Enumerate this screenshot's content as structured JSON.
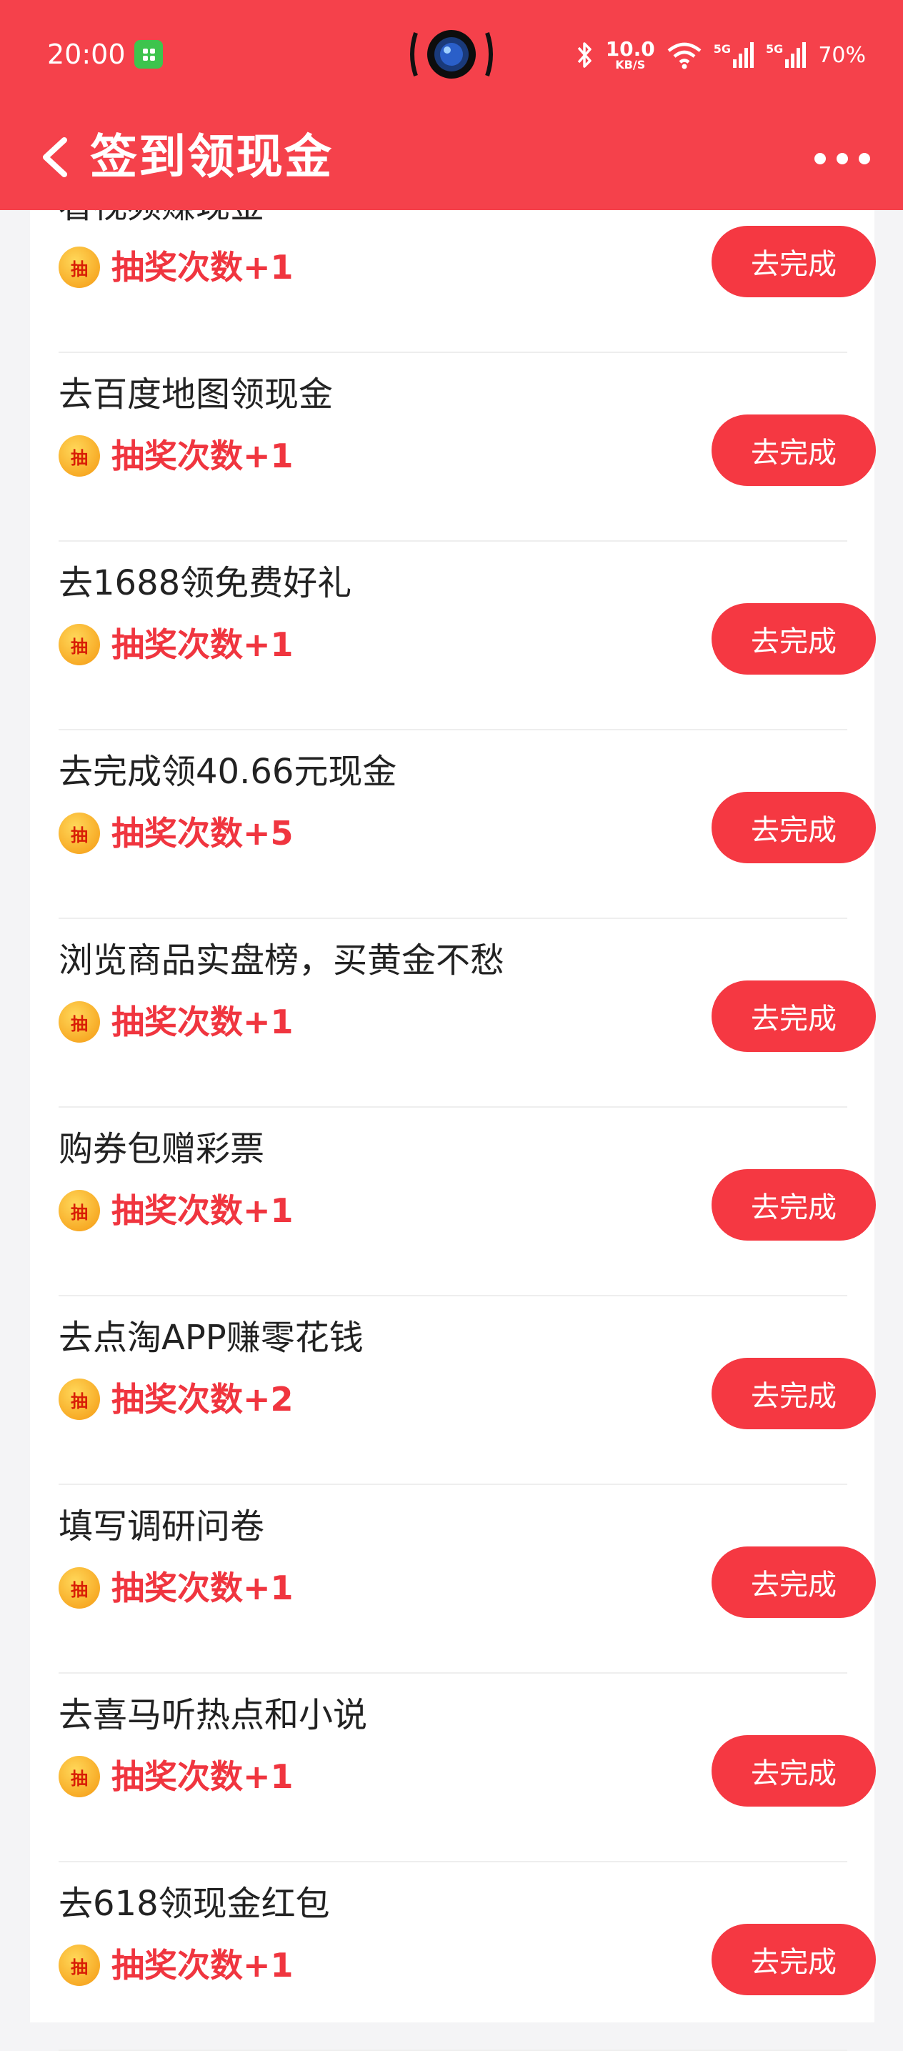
{
  "status_bar": {
    "time": "20:00",
    "network_speed_value": "10.0",
    "network_speed_unit": "KB/S",
    "signal_1_label": "5G",
    "signal_2_label": "5G",
    "battery": "70%"
  },
  "header": {
    "title": "签到领现金"
  },
  "colors": {
    "header_bg": "#f5414b",
    "accent_red": "#f0353f",
    "button_bg": "#f53842",
    "page_bg": "#f4f4f6"
  },
  "tasks": [
    {
      "title": "看视频赚现金",
      "reward": "抽奖次数+1",
      "button": "去完成",
      "reward_icon": "抽"
    },
    {
      "title": "去百度地图领现金",
      "reward": "抽奖次数+1",
      "button": "去完成",
      "reward_icon": "抽"
    },
    {
      "title": "去1688领免费好礼",
      "reward": "抽奖次数+1",
      "button": "去完成",
      "reward_icon": "抽"
    },
    {
      "title": "去完成领40.66元现金",
      "reward": "抽奖次数+5",
      "button": "去完成",
      "reward_icon": "抽"
    },
    {
      "title": "浏览商品实盘榜，买黄金不愁",
      "reward": "抽奖次数+1",
      "button": "去完成",
      "reward_icon": "抽"
    },
    {
      "title": "购券包赠彩票",
      "reward": "抽奖次数+1",
      "button": "去完成",
      "reward_icon": "抽"
    },
    {
      "title": "去点淘APP赚零花钱",
      "reward": "抽奖次数+2",
      "button": "去完成",
      "reward_icon": "抽"
    },
    {
      "title": "填写调研问卷",
      "reward": "抽奖次数+1",
      "button": "去完成",
      "reward_icon": "抽"
    },
    {
      "title": "去喜马听热点和小说",
      "reward": "抽奖次数+1",
      "button": "去完成",
      "reward_icon": "抽"
    },
    {
      "title": "去618领现金红包",
      "reward": "抽奖次数+1",
      "button": "去完成",
      "reward_icon": "抽"
    }
  ]
}
